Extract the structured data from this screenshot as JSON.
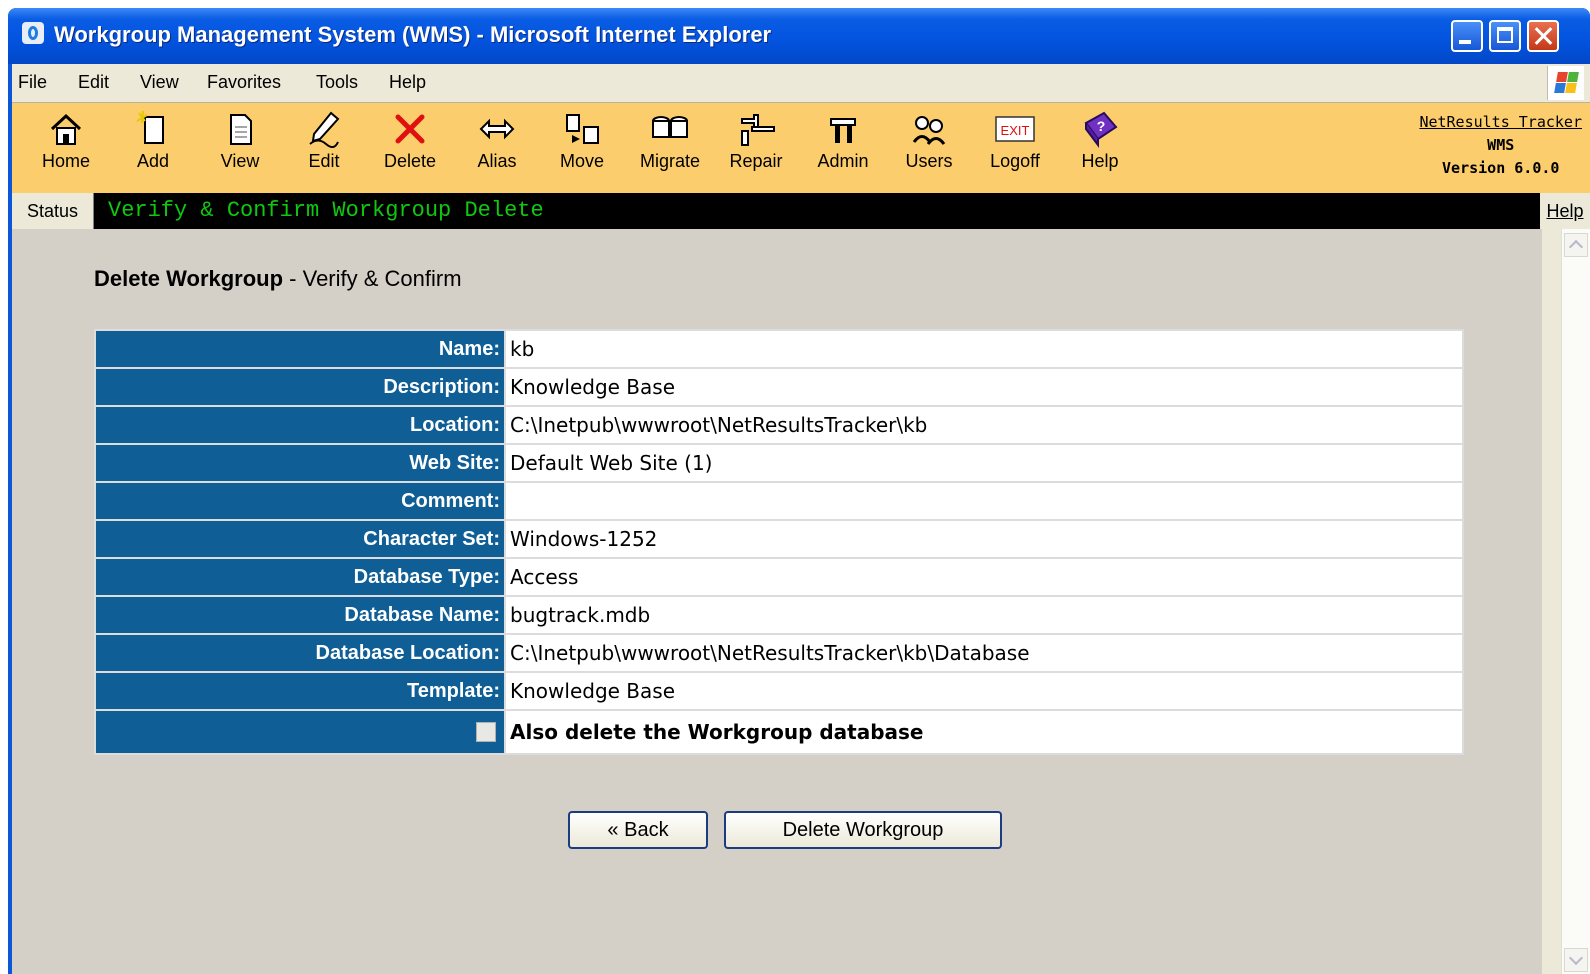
{
  "window": {
    "title": "Workgroup Management System (WMS) - Microsoft Internet Explorer"
  },
  "menu": [
    "File",
    "Edit",
    "View",
    "Favorites",
    "Tools",
    "Help"
  ],
  "toolbar": {
    "items": [
      {
        "label": "Home",
        "icon": "home-icon"
      },
      {
        "label": "Add",
        "icon": "add-icon"
      },
      {
        "label": "View",
        "icon": "view-icon"
      },
      {
        "label": "Edit",
        "icon": "edit-icon"
      },
      {
        "label": "Delete",
        "icon": "delete-icon"
      },
      {
        "label": "Alias",
        "icon": "alias-icon"
      },
      {
        "label": "Move",
        "icon": "move-icon"
      },
      {
        "label": "Migrate",
        "icon": "migrate-icon"
      },
      {
        "label": "Repair",
        "icon": "repair-icon"
      },
      {
        "label": "Admin",
        "icon": "admin-icon"
      },
      {
        "label": "Users",
        "icon": "users-icon"
      },
      {
        "label": "Logoff",
        "icon": "exit-icon"
      },
      {
        "label": "Help",
        "icon": "help-icon"
      }
    ],
    "exit_text": "EXIT",
    "product_link": "NetResults Tracker",
    "product_abbr": "WMS",
    "version": "Version 6.0.0"
  },
  "status": {
    "label": "Status",
    "text": "Verify & Confirm Workgroup Delete",
    "help": "Help"
  },
  "page": {
    "heading_strong": "Delete Workgroup",
    "heading_rest": " - Verify & Confirm"
  },
  "fields": [
    {
      "label": "Name:",
      "value": "kb"
    },
    {
      "label": "Description:",
      "value": "Knowledge Base"
    },
    {
      "label": "Location:",
      "value": "C:\\Inetpub\\wwwroot\\NetResultsTracker\\kb"
    },
    {
      "label": "Web Site:",
      "value": "Default Web Site (1)"
    },
    {
      "label": "Comment:",
      "value": ""
    },
    {
      "label": "Character Set:",
      "value": "Windows-1252"
    },
    {
      "label": "Database Type:",
      "value": "Access"
    },
    {
      "label": "Database Name:",
      "value": "bugtrack.mdb"
    },
    {
      "label": "Database Location:",
      "value": "C:\\Inetpub\\wwwroot\\NetResultsTracker\\kb\\Database"
    },
    {
      "label": "Template:",
      "value": "Knowledge Base"
    }
  ],
  "delete_db": {
    "label": "Also delete the Workgroup database",
    "checked": false
  },
  "buttons": {
    "back": "« Back",
    "delete": "Delete Workgroup"
  },
  "colors": {
    "label_bg": "#0f5f96",
    "toolbar_bg": "#fccd6c",
    "status_text": "#0fc80f"
  }
}
